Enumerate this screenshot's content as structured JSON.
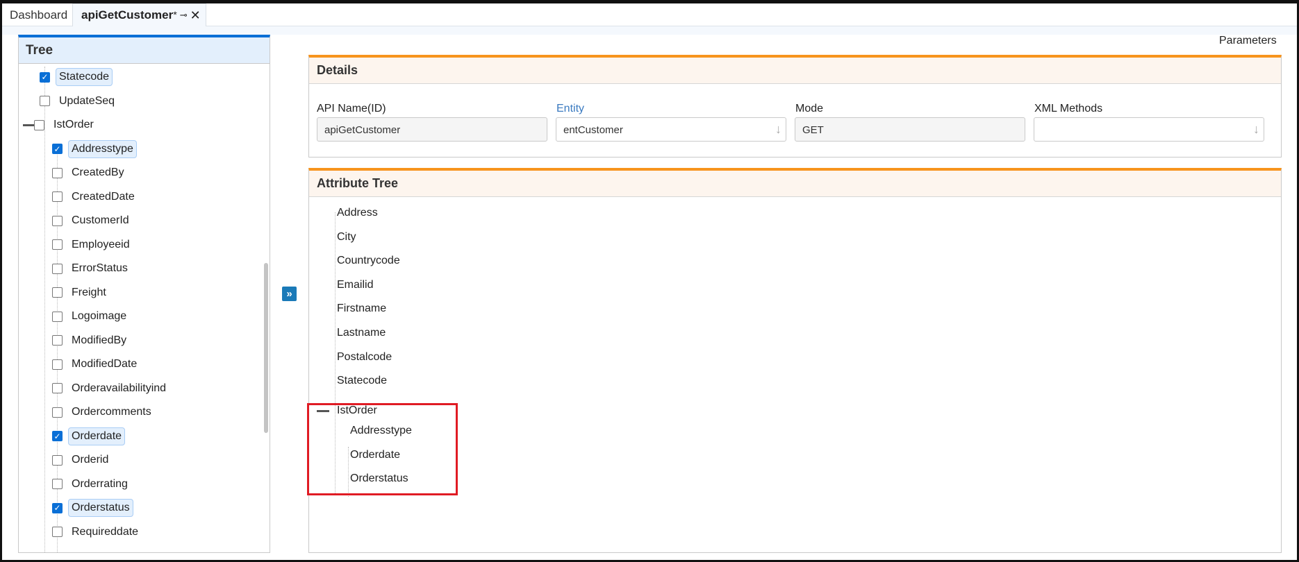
{
  "tabs": [
    {
      "label": "Dashboard"
    },
    {
      "label": "apiGetCustomer",
      "modified": "*"
    }
  ],
  "tree": {
    "title": "Tree",
    "top_items": [
      {
        "label": "Statecode",
        "checked": true
      },
      {
        "label": "UpdateSeq",
        "checked": false
      }
    ],
    "group": {
      "label": "IstOrder",
      "checked": false
    },
    "children": [
      {
        "label": "Addresstype",
        "checked": true
      },
      {
        "label": "CreatedBy",
        "checked": false
      },
      {
        "label": "CreatedDate",
        "checked": false
      },
      {
        "label": "CustomerId",
        "checked": false
      },
      {
        "label": "Employeeid",
        "checked": false
      },
      {
        "label": "ErrorStatus",
        "checked": false
      },
      {
        "label": "Freight",
        "checked": false
      },
      {
        "label": "Logoimage",
        "checked": false
      },
      {
        "label": "ModifiedBy",
        "checked": false
      },
      {
        "label": "ModifiedDate",
        "checked": false
      },
      {
        "label": "Orderavailabilityind",
        "checked": false
      },
      {
        "label": "Ordercomments",
        "checked": false
      },
      {
        "label": "Orderdate",
        "checked": true
      },
      {
        "label": "Orderid",
        "checked": false
      },
      {
        "label": "Orderrating",
        "checked": false
      },
      {
        "label": "Orderstatus",
        "checked": true
      },
      {
        "label": "Requireddate",
        "checked": false
      }
    ]
  },
  "parameters_link": "Parameters",
  "details": {
    "title": "Details",
    "fields": [
      {
        "label": "API Name(ID)",
        "value": "apiGetCustomer"
      },
      {
        "label": "Entity",
        "value": "entCustomer"
      },
      {
        "label": "Mode",
        "value": "GET"
      },
      {
        "label": "XML Methods",
        "value": ""
      }
    ]
  },
  "attribute_tree": {
    "title": "Attribute Tree",
    "items": [
      "Address",
      "City",
      "Countrycode",
      "Emailid",
      "Firstname",
      "Lastname",
      "Postalcode",
      "Statecode"
    ],
    "group": "IstOrder",
    "children": [
      "Addresstype",
      "Orderdate",
      "Orderstatus"
    ]
  },
  "colors": {
    "accent_blue": "#0a6fd6",
    "accent_orange": "#f7941d",
    "highlight": "#e01b24"
  }
}
